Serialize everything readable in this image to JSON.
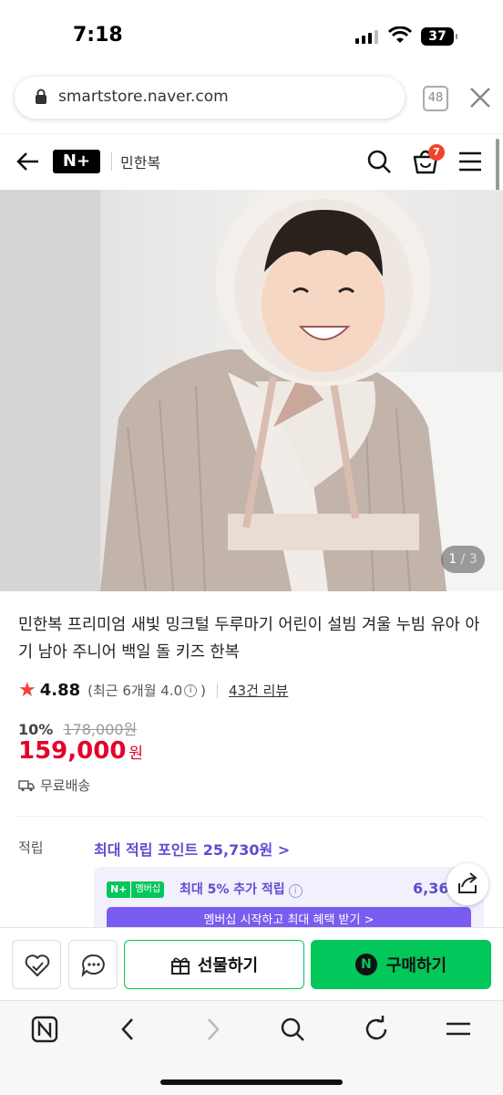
{
  "status_bar": {
    "time": "7:18",
    "battery": "37"
  },
  "browser": {
    "url": "smartstore.naver.com",
    "tab_count": "48"
  },
  "store_header": {
    "brand_badge": "N+",
    "store_name": "민한복",
    "cart_count": "7"
  },
  "product": {
    "image_pager": {
      "current": "1",
      "separator": "/",
      "total": "3"
    },
    "title": "민한복 프리미엄 새빛 밍크털 두루마기 어린이 설빔 겨울 누빔 유아 아기 남아 주니어 백일 돌 키즈 한복",
    "rating": {
      "score": "4.88",
      "recent_prefix": "(최근 6개월 4.0",
      "recent_suffix": ")",
      "info_mark": "i",
      "reviews": "43건 리뷰"
    },
    "discount_rate": "10%",
    "original_price": "178,000원",
    "price": "159,000",
    "price_unit": "원",
    "shipping": "무료배송"
  },
  "points": {
    "label": "적립",
    "max_points": "최대 적립 포인트 25,730원 >",
    "membership_badge_left": "N+",
    "membership_badge_right": "멤버십",
    "membership_text": "최대 5% 추가 적립",
    "membership_value": "6,36",
    "membership_cta": "멤버십 시작하고 최대 혜택 받기 >"
  },
  "actions": {
    "gift_label": "선물하기",
    "buy_label": "구매하기",
    "buy_logo": "N"
  },
  "colors": {
    "naver_green": "#03c75a",
    "price_red": "#e4002b",
    "membership_purple": "#5b4dd1"
  },
  "icons": [
    "back-arrow-icon",
    "search-icon",
    "cart-icon",
    "menu-icon",
    "lock-icon",
    "close-icon",
    "star-icon",
    "truck-icon",
    "info-icon",
    "share-icon",
    "wishlist-heart-icon",
    "chat-icon",
    "gift-icon",
    "naver-home-icon",
    "chevron-left-icon",
    "chevron-right-icon",
    "reload-icon"
  ]
}
